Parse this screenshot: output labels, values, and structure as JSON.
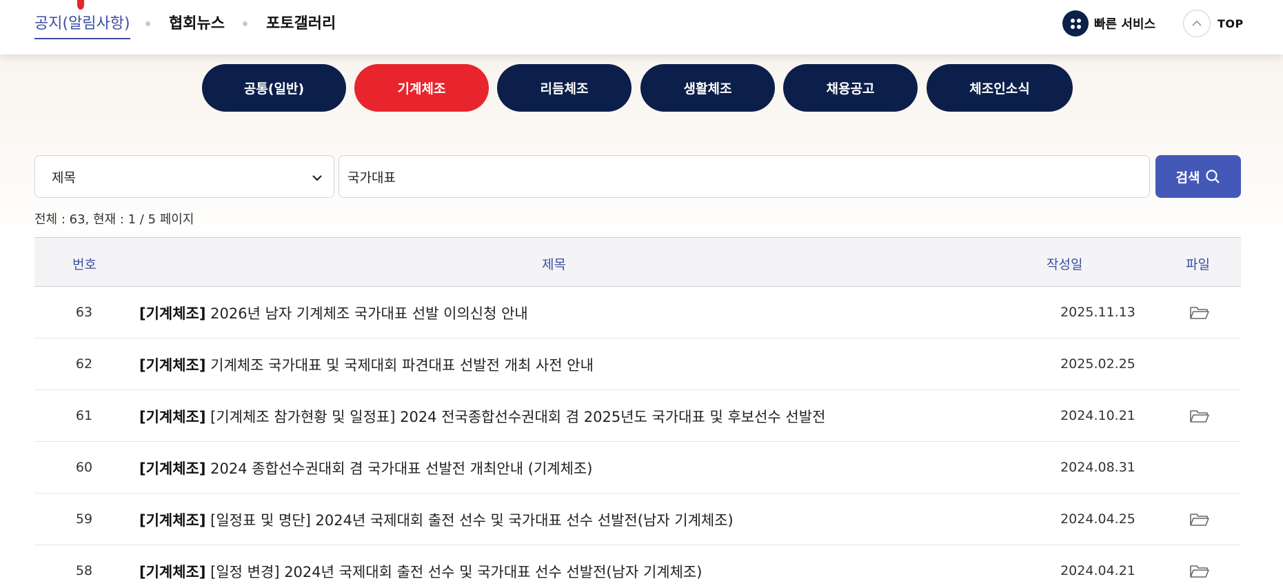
{
  "top_tabs": [
    {
      "label": "공지(알림사항)",
      "active": true
    },
    {
      "label": "협회뉴스",
      "active": false
    },
    {
      "label": "포토갤러리",
      "active": false
    }
  ],
  "quick_service": {
    "label": "빠른 서비스",
    "icon": "grid-dots-icon"
  },
  "top_button": {
    "label": "TOP",
    "icon": "chevron-up-icon"
  },
  "categories": [
    {
      "label": "공통(일반)",
      "active": false
    },
    {
      "label": "기계체조",
      "active": true
    },
    {
      "label": "리듬체조",
      "active": false
    },
    {
      "label": "생활체조",
      "active": false
    },
    {
      "label": "채용공고",
      "active": false
    },
    {
      "label": "체조인소식",
      "active": false
    }
  ],
  "search": {
    "field_selected": "제목",
    "query": "국가대표",
    "button_label": "검색"
  },
  "summary": "전체 : 63, 현재 : 1 / 5 페이지",
  "table": {
    "headers": {
      "no": "번호",
      "title": "제목",
      "date": "작성일",
      "file": "파일"
    },
    "rows": [
      {
        "no": "63",
        "tag": "[기계체조]",
        "title": "2026년 남자 기계체조 국가대표 선발 이의신청 안내",
        "date": "2025.11.13",
        "has_file": true
      },
      {
        "no": "62",
        "tag": "[기계체조]",
        "title": "기계체조 국가대표 및 국제대회 파견대표 선발전 개최 사전 안내",
        "date": "2025.02.25",
        "has_file": false
      },
      {
        "no": "61",
        "tag": "[기계체조]",
        "title": "[기계체조 참가현황 및 일정표] 2024 전국종합선수권대회 겸 2025년도 국가대표 및 후보선수 선발전",
        "date": "2024.10.21",
        "has_file": true
      },
      {
        "no": "60",
        "tag": "[기계체조]",
        "title": "2024 종합선수권대회 겸 국가대표 선발전 개최안내 (기계체조)",
        "date": "2024.08.31",
        "has_file": false
      },
      {
        "no": "59",
        "tag": "[기계체조]",
        "title": "[일정표 및 명단] 2024년 국제대회 출전 선수 및 국가대표 선수 선발전(남자 기계체조)",
        "date": "2024.04.25",
        "has_file": true
      },
      {
        "no": "58",
        "tag": "[기계체조]",
        "title": "[일정 변경] 2024년 국제대회 출전 선수 및 국가대표 선수 선발전(남자 기계체조)",
        "date": "2024.04.21",
        "has_file": true
      }
    ]
  },
  "colors": {
    "navy": "#0c1f4a",
    "accent_red": "#e8242d",
    "accent_blue": "#4458b8"
  }
}
